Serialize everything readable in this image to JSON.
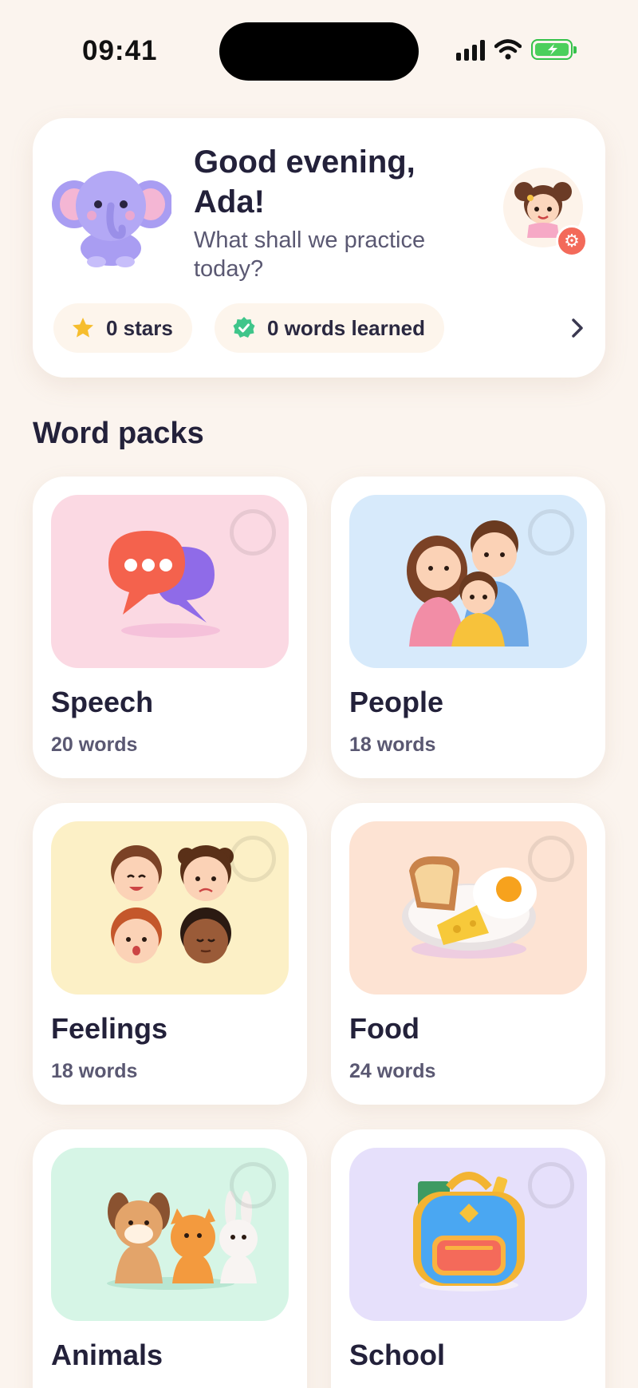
{
  "status": {
    "time": "09:41",
    "battery_color": "#35c24a"
  },
  "greeting": {
    "title": "Good evening, Ada!",
    "subtitle": "What shall we practice today?",
    "stars_label": "0 stars",
    "words_label": "0 words learned"
  },
  "section_title": "Word packs",
  "packs": [
    {
      "name": "Speech",
      "count": "20 words",
      "bg": "#fbd9e3",
      "icon": "speech-bubbles-icon"
    },
    {
      "name": "People",
      "count": "18 words",
      "bg": "#d7eafb",
      "icon": "family-icon"
    },
    {
      "name": "Feelings",
      "count": "18 words",
      "bg": "#fcf0c6",
      "icon": "faces-icon"
    },
    {
      "name": "Food",
      "count": "24 words",
      "bg": "#fde3d3",
      "icon": "breakfast-icon"
    },
    {
      "name": "Animals",
      "count": "",
      "bg": "#d6f5e6",
      "icon": "pets-icon"
    },
    {
      "name": "School",
      "count": "",
      "bg": "#e6e0fb",
      "icon": "backpack-icon"
    }
  ]
}
